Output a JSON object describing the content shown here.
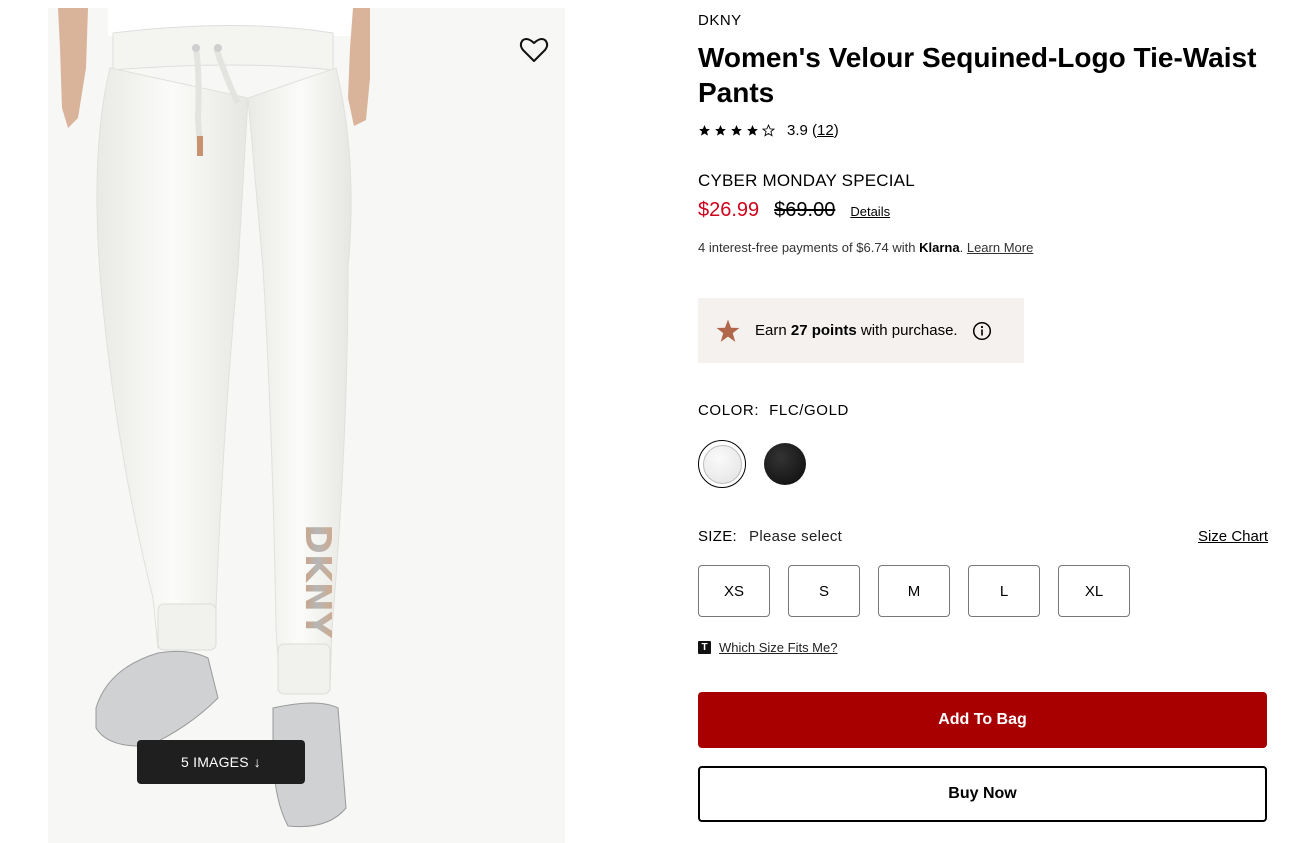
{
  "gallery": {
    "images_button_label": "5 IMAGES",
    "images_button_arrow": "↓",
    "wishlist_icon": "heart-icon",
    "logo_text": "DKNY"
  },
  "product": {
    "brand": "DKNY",
    "title": "Women's Velour Sequined-Logo Tie-Waist Pants",
    "rating": {
      "stars_filled": 3.9,
      "score": "3.9",
      "count": "12"
    },
    "promo_label": "CYBER MONDAY SPECIAL",
    "sale_price": "$26.99",
    "original_price": "$69.00",
    "details_link": "Details",
    "klarna": {
      "prefix": "4 interest-free payments of $6.74 with ",
      "brand": "Klarna",
      "suffix": ".",
      "learn_more": "Learn More"
    },
    "points": {
      "prefix": "Earn ",
      "value": "27 points",
      "suffix": " with purchase."
    },
    "color": {
      "label": "COLOR:",
      "value": "FLC/GOLD",
      "swatches": [
        "white",
        "black"
      ]
    },
    "size": {
      "label": "SIZE:",
      "value": "Please select",
      "chart_link": "Size Chart",
      "options": [
        "XS",
        "S",
        "M",
        "L",
        "XL"
      ],
      "fit_icon_letter": "T",
      "fit_link": "Which Size Fits Me?"
    },
    "actions": {
      "add_to_bag": "Add To Bag",
      "buy_now": "Buy Now"
    }
  },
  "colors": {
    "sale_red": "#d0021b",
    "add_to_bag_bg": "#a80000",
    "points_bg": "#f5f1ee",
    "points_star": "#b0674a"
  }
}
